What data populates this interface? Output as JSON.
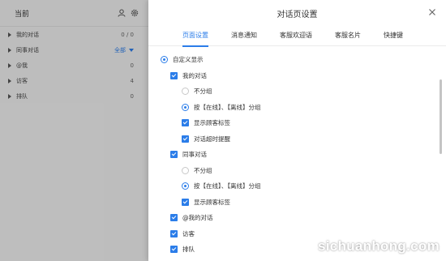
{
  "left_panel": {
    "title": "当前",
    "rows": [
      {
        "label": "我的对话",
        "count": "0 / 0"
      },
      {
        "label": "同事对话",
        "filter": "全部"
      },
      {
        "label": "@我",
        "count": "0"
      },
      {
        "label": "访客",
        "count": "4"
      },
      {
        "label": "排队",
        "count": "0"
      }
    ]
  },
  "drawer": {
    "title": "对话页设置",
    "tabs": [
      "页面设置",
      "消息通知",
      "客服欢迎语",
      "客服名片",
      "快捷键"
    ],
    "active_tab": "页面设置"
  },
  "settings": {
    "custom_display": "自定义显示",
    "my_chats": "我的对话",
    "no_group_1": "不分组",
    "group_online_1": "按【在线】、【离线】分组",
    "show_tags_1": "显示顾客标签",
    "timeout_remind": "对话超时提醒",
    "colleague_chats": "同事对话",
    "no_group_2": "不分组",
    "group_online_2": "按【在线】、【离线】分组",
    "show_tags_2": "显示顾客标签",
    "at_my_chats": "@我的对话",
    "visitors": "访客",
    "queue": "排队"
  },
  "watermark": "sichuanhong.com",
  "colors": {
    "accent": "#2b7de9",
    "overlay": "rgba(0,0,0,0.22)"
  }
}
